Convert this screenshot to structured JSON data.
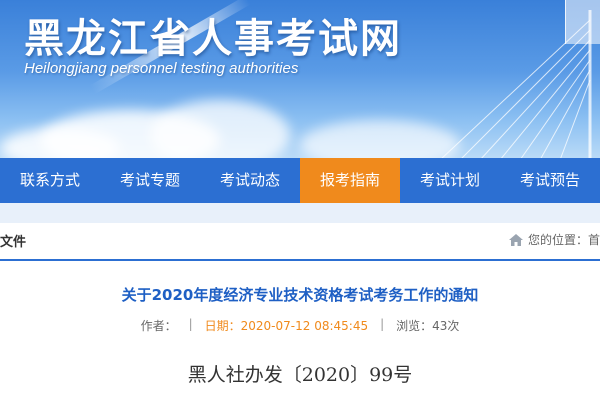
{
  "header": {
    "site_title": "黑龙江省人事考试网",
    "site_subtitle": "Heilongjiang personnel testing authorities"
  },
  "nav": {
    "items": [
      {
        "label": "联系方式",
        "active": false
      },
      {
        "label": "考试专题",
        "active": false
      },
      {
        "label": "考试动态",
        "active": false
      },
      {
        "label": "报考指南",
        "active": true
      },
      {
        "label": "考试计划",
        "active": false
      },
      {
        "label": "考试预告",
        "active": false
      }
    ]
  },
  "breadcrumb": {
    "section_label": "文件",
    "location_text": "您的位置：首"
  },
  "article": {
    "title": "关于2020年度经济专业技术资格考试考务工作的通知",
    "author_label": "作者：",
    "date_label": "日期：",
    "date_value": "2020-07-12 08:45:45",
    "views_label": "浏览：",
    "views_value": "43次",
    "doc_number": "黑人社办发〔2020〕99号"
  },
  "colors": {
    "nav_bg": "#2c6fd2",
    "nav_active": "#f08a1c",
    "title_blue": "#1e5fc4",
    "date_orange": "#f08a1c"
  }
}
